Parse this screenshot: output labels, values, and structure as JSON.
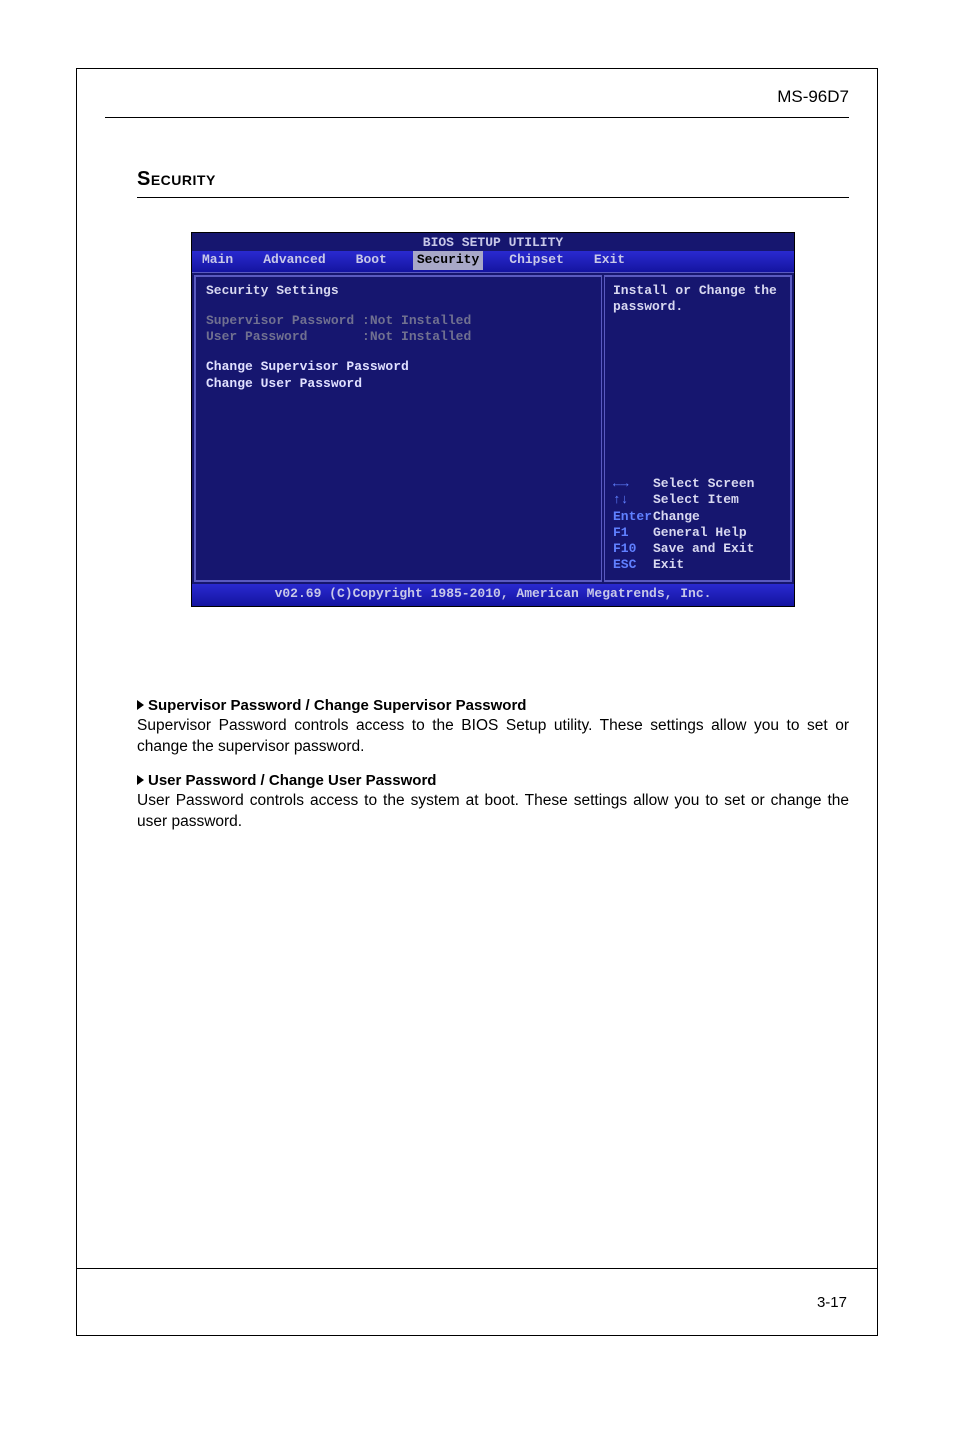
{
  "header": {
    "model": "MS-96D7"
  },
  "section": {
    "title": "Security"
  },
  "bios": {
    "title": "BIOS SETUP UTILITY",
    "tabs": [
      "Main",
      "Advanced",
      "Boot",
      "Security",
      "Chipset",
      "Exit"
    ],
    "active_tab": "Security",
    "left": {
      "heading": "Security Settings",
      "rows": [
        {
          "label": "Supervisor Password",
          "value": ":Not Installed"
        },
        {
          "label": "User Password",
          "value": ":Not Installed"
        }
      ],
      "actions": [
        "Change Supervisor Password",
        "Change User Password"
      ]
    },
    "right": {
      "help": "Install or Change the password.",
      "keys": [
        {
          "key": "←→",
          "desc": "Select Screen"
        },
        {
          "key": "↑↓",
          "desc": "Select Item"
        },
        {
          "key": "Enter",
          "desc": "Change"
        },
        {
          "key": "F1",
          "desc": "General Help"
        },
        {
          "key": "F10",
          "desc": "Save and Exit"
        },
        {
          "key": "ESC",
          "desc": "Exit"
        }
      ]
    },
    "footer": "v02.69 (C)Copyright 1985-2010, American Megatrends, Inc."
  },
  "descriptions": [
    {
      "title": "Supervisor Password / Change Supervisor Password",
      "text": "Supervisor Password controls access to the BIOS Setup utility. These settings allow you to set or change the supervisor password."
    },
    {
      "title": "User Password / Change User Password",
      "text": "User Password controls access to the system at boot. These settings allow you to set or change the user password."
    }
  ],
  "page_number": "3-17"
}
